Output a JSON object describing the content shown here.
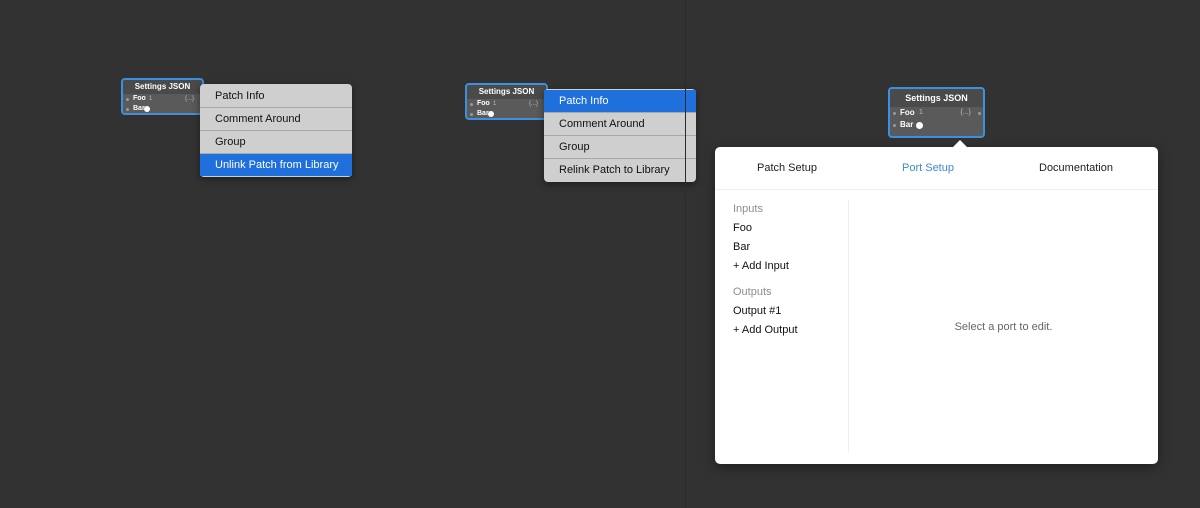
{
  "node": {
    "title": "Settings JSON",
    "inputs": [
      {
        "label": "Foo",
        "value": "1"
      },
      {
        "label": "Bar"
      }
    ],
    "output_value": "{...}"
  },
  "context_menu_linked": {
    "items": [
      "Patch Info",
      "Comment Around",
      "Group",
      "Unlink Patch from Library"
    ],
    "highlighted": "Unlink Patch from Library"
  },
  "context_menu_unlinked": {
    "items": [
      "Patch Info",
      "Comment Around",
      "Group",
      "Relink Patch to Library"
    ],
    "highlighted": "Patch Info"
  },
  "popover": {
    "tabs": [
      "Patch Setup",
      "Port Setup",
      "Documentation"
    ],
    "active_tab": "Port Setup",
    "inputs_header": "Inputs",
    "inputs": [
      "Foo",
      "Bar"
    ],
    "add_input": "+ Add Input",
    "outputs_header": "Outputs",
    "outputs": [
      "Output #1"
    ],
    "add_output": "+ Add Output",
    "empty_message": "Select a port to edit."
  },
  "colors": {
    "canvas": "#323232",
    "accent": "#3f8fe0",
    "menu_highlight": "#1f6fdc",
    "active_tab": "#3a8ad6"
  }
}
